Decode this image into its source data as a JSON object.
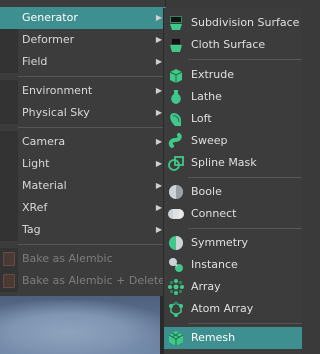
{
  "main_menu": {
    "items": [
      {
        "label": "Generator",
        "arrow": "▶"
      },
      {
        "label": "Deformer",
        "arrow": "▶"
      },
      {
        "label": "Field",
        "arrow": "▶"
      },
      {
        "label": "Environment",
        "arrow": "▶"
      },
      {
        "label": "Physical Sky",
        "arrow": "▶"
      },
      {
        "label": "Camera",
        "arrow": "▶"
      },
      {
        "label": "Light",
        "arrow": "▶"
      },
      {
        "label": "Material",
        "arrow": "▶"
      },
      {
        "label": "XRef",
        "arrow": "▶"
      },
      {
        "label": "Tag",
        "arrow": "▶"
      },
      {
        "label": "Bake as Alembic"
      },
      {
        "label": "Bake as Alembic + Delete"
      }
    ]
  },
  "generator_submenu": {
    "items": [
      {
        "label": "Subdivision Surface"
      },
      {
        "label": "Cloth Surface"
      },
      {
        "label": "Extrude"
      },
      {
        "label": "Lathe"
      },
      {
        "label": "Loft"
      },
      {
        "label": "Sweep"
      },
      {
        "label": "Spline Mask"
      },
      {
        "label": "Boole"
      },
      {
        "label": "Connect"
      },
      {
        "label": "Symmetry"
      },
      {
        "label": "Instance"
      },
      {
        "label": "Array"
      },
      {
        "label": "Atom Array"
      },
      {
        "label": "Remesh"
      }
    ]
  },
  "colors": {
    "highlight": "#3e8f8f",
    "generator_icon": "#3fc88a",
    "menu_bg": "#3c3c3c",
    "disabled_text": "#7d7d7d"
  }
}
